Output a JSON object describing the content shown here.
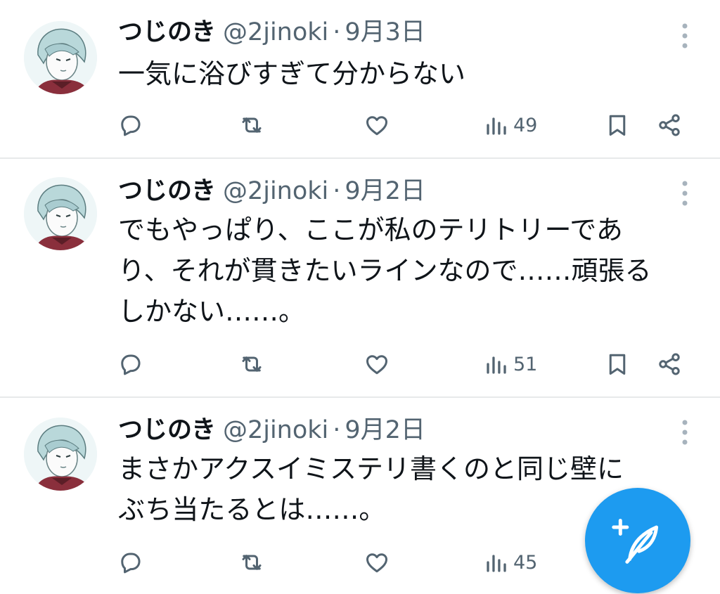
{
  "tweets": [
    {
      "name": "つじのき",
      "handle": "@2jinoki",
      "separator": "·",
      "date": "9月3日",
      "lines": [
        "一気に浴びすぎて分からない"
      ],
      "views": "49"
    },
    {
      "name": "つじのき",
      "handle": "@2jinoki",
      "separator": "·",
      "date": "9月2日",
      "lines": [
        "でもやっぱり、ここが私のテリトリーであ",
        "り、それが貫きたいラインなので……頑張る",
        "しかない……。"
      ],
      "views": "51"
    },
    {
      "name": "つじのき",
      "handle": "@2jinoki",
      "separator": "·",
      "date": "9月2日",
      "lines": [
        "まさかアクスイミステリ書くのと同じ壁に",
        "ぶち当たるとは……。"
      ],
      "views": "45"
    }
  ],
  "colors": {
    "accent": "#1d9bf0",
    "secondary_text": "#536471",
    "divider": "#e7e9ea"
  },
  "icons": {
    "reply": "reply-icon",
    "retweet": "retweet-icon",
    "like": "heart-icon",
    "views": "views-chart-icon",
    "bookmark": "bookmark-icon",
    "share": "share-icon",
    "more": "more-vertical-icon",
    "compose": "compose-feather-icon"
  }
}
